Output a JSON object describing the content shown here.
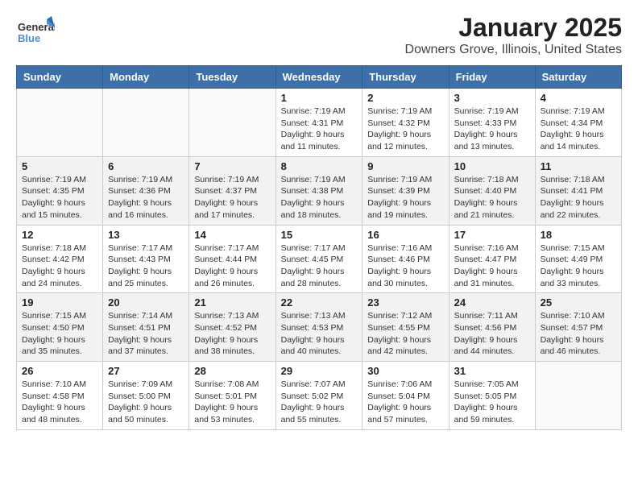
{
  "logo": {
    "text_general": "General",
    "text_blue": "Blue"
  },
  "title": "January 2025",
  "subtitle": "Downers Grove, Illinois, United States",
  "headers": [
    "Sunday",
    "Monday",
    "Tuesday",
    "Wednesday",
    "Thursday",
    "Friday",
    "Saturday"
  ],
  "weeks": [
    [
      {
        "day": "",
        "sunrise": "",
        "sunset": "",
        "daylight": ""
      },
      {
        "day": "",
        "sunrise": "",
        "sunset": "",
        "daylight": ""
      },
      {
        "day": "",
        "sunrise": "",
        "sunset": "",
        "daylight": ""
      },
      {
        "day": "1",
        "sunrise": "Sunrise: 7:19 AM",
        "sunset": "Sunset: 4:31 PM",
        "daylight": "Daylight: 9 hours and 11 minutes."
      },
      {
        "day": "2",
        "sunrise": "Sunrise: 7:19 AM",
        "sunset": "Sunset: 4:32 PM",
        "daylight": "Daylight: 9 hours and 12 minutes."
      },
      {
        "day": "3",
        "sunrise": "Sunrise: 7:19 AM",
        "sunset": "Sunset: 4:33 PM",
        "daylight": "Daylight: 9 hours and 13 minutes."
      },
      {
        "day": "4",
        "sunrise": "Sunrise: 7:19 AM",
        "sunset": "Sunset: 4:34 PM",
        "daylight": "Daylight: 9 hours and 14 minutes."
      }
    ],
    [
      {
        "day": "5",
        "sunrise": "Sunrise: 7:19 AM",
        "sunset": "Sunset: 4:35 PM",
        "daylight": "Daylight: 9 hours and 15 minutes."
      },
      {
        "day": "6",
        "sunrise": "Sunrise: 7:19 AM",
        "sunset": "Sunset: 4:36 PM",
        "daylight": "Daylight: 9 hours and 16 minutes."
      },
      {
        "day": "7",
        "sunrise": "Sunrise: 7:19 AM",
        "sunset": "Sunset: 4:37 PM",
        "daylight": "Daylight: 9 hours and 17 minutes."
      },
      {
        "day": "8",
        "sunrise": "Sunrise: 7:19 AM",
        "sunset": "Sunset: 4:38 PM",
        "daylight": "Daylight: 9 hours and 18 minutes."
      },
      {
        "day": "9",
        "sunrise": "Sunrise: 7:19 AM",
        "sunset": "Sunset: 4:39 PM",
        "daylight": "Daylight: 9 hours and 19 minutes."
      },
      {
        "day": "10",
        "sunrise": "Sunrise: 7:18 AM",
        "sunset": "Sunset: 4:40 PM",
        "daylight": "Daylight: 9 hours and 21 minutes."
      },
      {
        "day": "11",
        "sunrise": "Sunrise: 7:18 AM",
        "sunset": "Sunset: 4:41 PM",
        "daylight": "Daylight: 9 hours and 22 minutes."
      }
    ],
    [
      {
        "day": "12",
        "sunrise": "Sunrise: 7:18 AM",
        "sunset": "Sunset: 4:42 PM",
        "daylight": "Daylight: 9 hours and 24 minutes."
      },
      {
        "day": "13",
        "sunrise": "Sunrise: 7:17 AM",
        "sunset": "Sunset: 4:43 PM",
        "daylight": "Daylight: 9 hours and 25 minutes."
      },
      {
        "day": "14",
        "sunrise": "Sunrise: 7:17 AM",
        "sunset": "Sunset: 4:44 PM",
        "daylight": "Daylight: 9 hours and 26 minutes."
      },
      {
        "day": "15",
        "sunrise": "Sunrise: 7:17 AM",
        "sunset": "Sunset: 4:45 PM",
        "daylight": "Daylight: 9 hours and 28 minutes."
      },
      {
        "day": "16",
        "sunrise": "Sunrise: 7:16 AM",
        "sunset": "Sunset: 4:46 PM",
        "daylight": "Daylight: 9 hours and 30 minutes."
      },
      {
        "day": "17",
        "sunrise": "Sunrise: 7:16 AM",
        "sunset": "Sunset: 4:47 PM",
        "daylight": "Daylight: 9 hours and 31 minutes."
      },
      {
        "day": "18",
        "sunrise": "Sunrise: 7:15 AM",
        "sunset": "Sunset: 4:49 PM",
        "daylight": "Daylight: 9 hours and 33 minutes."
      }
    ],
    [
      {
        "day": "19",
        "sunrise": "Sunrise: 7:15 AM",
        "sunset": "Sunset: 4:50 PM",
        "daylight": "Daylight: 9 hours and 35 minutes."
      },
      {
        "day": "20",
        "sunrise": "Sunrise: 7:14 AM",
        "sunset": "Sunset: 4:51 PM",
        "daylight": "Daylight: 9 hours and 37 minutes."
      },
      {
        "day": "21",
        "sunrise": "Sunrise: 7:13 AM",
        "sunset": "Sunset: 4:52 PM",
        "daylight": "Daylight: 9 hours and 38 minutes."
      },
      {
        "day": "22",
        "sunrise": "Sunrise: 7:13 AM",
        "sunset": "Sunset: 4:53 PM",
        "daylight": "Daylight: 9 hours and 40 minutes."
      },
      {
        "day": "23",
        "sunrise": "Sunrise: 7:12 AM",
        "sunset": "Sunset: 4:55 PM",
        "daylight": "Daylight: 9 hours and 42 minutes."
      },
      {
        "day": "24",
        "sunrise": "Sunrise: 7:11 AM",
        "sunset": "Sunset: 4:56 PM",
        "daylight": "Daylight: 9 hours and 44 minutes."
      },
      {
        "day": "25",
        "sunrise": "Sunrise: 7:10 AM",
        "sunset": "Sunset: 4:57 PM",
        "daylight": "Daylight: 9 hours and 46 minutes."
      }
    ],
    [
      {
        "day": "26",
        "sunrise": "Sunrise: 7:10 AM",
        "sunset": "Sunset: 4:58 PM",
        "daylight": "Daylight: 9 hours and 48 minutes."
      },
      {
        "day": "27",
        "sunrise": "Sunrise: 7:09 AM",
        "sunset": "Sunset: 5:00 PM",
        "daylight": "Daylight: 9 hours and 50 minutes."
      },
      {
        "day": "28",
        "sunrise": "Sunrise: 7:08 AM",
        "sunset": "Sunset: 5:01 PM",
        "daylight": "Daylight: 9 hours and 53 minutes."
      },
      {
        "day": "29",
        "sunrise": "Sunrise: 7:07 AM",
        "sunset": "Sunset: 5:02 PM",
        "daylight": "Daylight: 9 hours and 55 minutes."
      },
      {
        "day": "30",
        "sunrise": "Sunrise: 7:06 AM",
        "sunset": "Sunset: 5:04 PM",
        "daylight": "Daylight: 9 hours and 57 minutes."
      },
      {
        "day": "31",
        "sunrise": "Sunrise: 7:05 AM",
        "sunset": "Sunset: 5:05 PM",
        "daylight": "Daylight: 9 hours and 59 minutes."
      },
      {
        "day": "",
        "sunrise": "",
        "sunset": "",
        "daylight": ""
      }
    ]
  ]
}
